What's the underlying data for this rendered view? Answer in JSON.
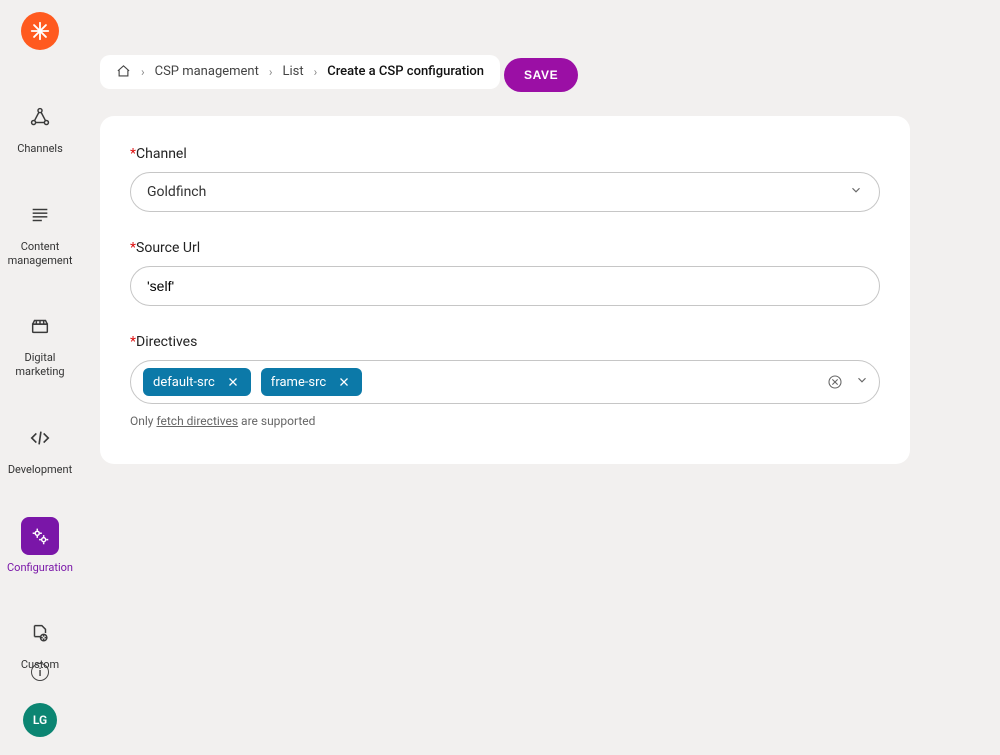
{
  "sidebar": {
    "items": [
      {
        "label": "Channels"
      },
      {
        "label": "Content management"
      },
      {
        "label": "Digital marketing"
      },
      {
        "label": "Development"
      },
      {
        "label": "Configuration"
      },
      {
        "label": "Custom"
      }
    ]
  },
  "breadcrumb": {
    "items": [
      "CSP management",
      "List"
    ],
    "current": "Create a CSP configuration"
  },
  "actions": {
    "save": "SAVE"
  },
  "form": {
    "channel": {
      "label": "Channel",
      "value": "Goldfinch"
    },
    "sourceUrl": {
      "label": "Source Url",
      "value": "'self'"
    },
    "directives": {
      "label": "Directives",
      "tags": [
        "default-src",
        "frame-src"
      ],
      "helper_pre": "Only ",
      "helper_link": "fetch directives",
      "helper_post": " are supported"
    }
  },
  "user": {
    "initials": "LG"
  }
}
